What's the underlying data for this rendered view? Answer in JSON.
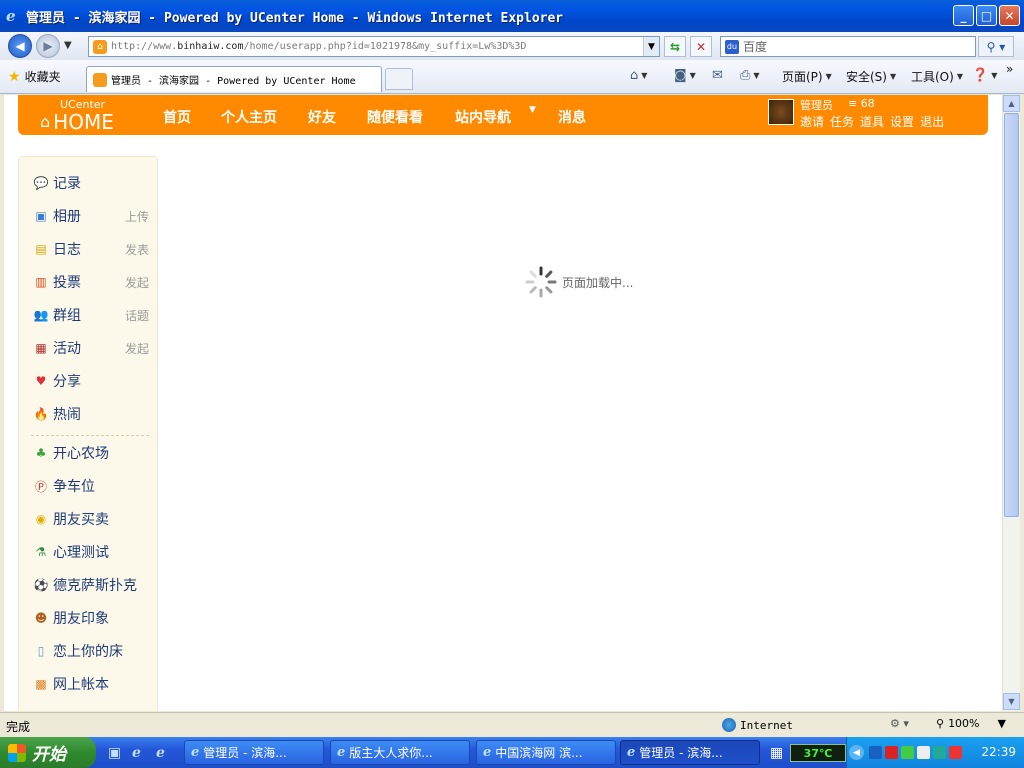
{
  "window": {
    "title": "管理员 - 滨海家园 - Powered by UCenter Home - Windows Internet Explorer",
    "min_label": "_",
    "max_label": "□",
    "close_label": "✕"
  },
  "address": {
    "url_prefix": "http://www.",
    "url_host": "binhaiw.com",
    "url_rest": "/home/userapp.php?id=1021978&my_suffix=Lw%3D%3D",
    "search_placeholder": "百度"
  },
  "command_bar": {
    "favorites_label": "收藏夹",
    "tab_title": "管理员 - 滨海家园 - Powered by UCenter Home",
    "page_label": "页面(P)",
    "safety_label": "安全(S)",
    "tools_label": "工具(O)",
    "more_label": "»"
  },
  "site_nav": {
    "logo_small": "UCenter",
    "logo_big": "HOME",
    "links": [
      "首页",
      "个人主页",
      "好友",
      "随便看看",
      "站内导航",
      "消息"
    ],
    "username": "管理员",
    "notice_count": "68",
    "user_links": [
      "邀请",
      "任务",
      "道具",
      "设置",
      "退出"
    ]
  },
  "sidebar": {
    "items": [
      {
        "label": "记录",
        "action": "",
        "icon": "speech-bubble-icon"
      },
      {
        "label": "相册",
        "action": "上传",
        "icon": "photo-icon"
      },
      {
        "label": "日志",
        "action": "发表",
        "icon": "notebook-icon"
      },
      {
        "label": "投票",
        "action": "发起",
        "icon": "bar-chart-icon"
      },
      {
        "label": "群组",
        "action": "话题",
        "icon": "group-icon"
      },
      {
        "label": "活动",
        "action": "发起",
        "icon": "calendar-icon"
      },
      {
        "label": "分享",
        "action": "",
        "icon": "hearts-icon"
      },
      {
        "label": "热闹",
        "action": "",
        "icon": "fire-icon"
      }
    ],
    "apps": [
      {
        "label": "开心农场",
        "icon": "sprout-icon"
      },
      {
        "label": "争车位",
        "icon": "parking-icon"
      },
      {
        "label": "朋友买卖",
        "icon": "coins-icon"
      },
      {
        "label": "心理测试",
        "icon": "flask-icon"
      },
      {
        "label": "德克萨斯扑克",
        "icon": "poker-chip-icon"
      },
      {
        "label": "朋友印象",
        "icon": "person-icon"
      },
      {
        "label": "恋上你的床",
        "icon": "bed-icon"
      },
      {
        "label": "网上帐本",
        "icon": "ledger-icon"
      }
    ]
  },
  "main": {
    "loading_text": "页面加载中..."
  },
  "status": {
    "text": "完成",
    "zone": "Internet",
    "zoom": "100%"
  },
  "taskbar": {
    "start_label": "开始",
    "tasks": [
      {
        "label": "管理员 - 滨海...",
        "active": false
      },
      {
        "label": "版主大人求你...",
        "active": false
      },
      {
        "label": "中国滨海网 滨...",
        "active": false
      },
      {
        "label": "管理员 - 滨海...",
        "active": true
      }
    ],
    "temperature": "37℃",
    "clock": "22:39"
  },
  "colors": {
    "site_orange": "#ff8a00",
    "sidebar_bg": "#fdf9ea",
    "link_blue": "#1e3a7a"
  }
}
